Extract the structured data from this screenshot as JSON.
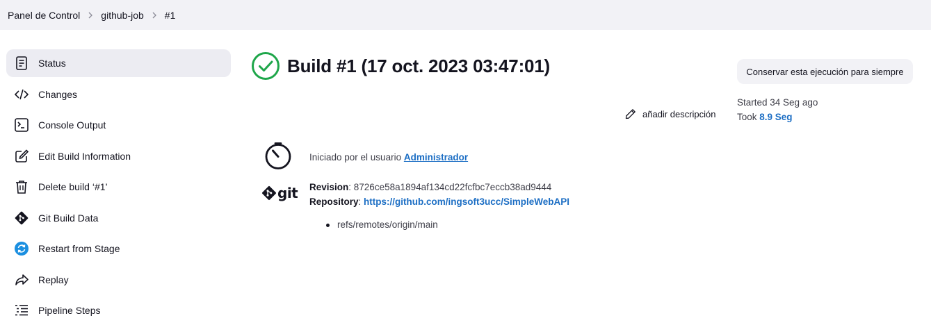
{
  "breadcrumb": {
    "items": [
      "Panel de Control",
      "github-job",
      "#1"
    ]
  },
  "sidebar": {
    "items": [
      {
        "label": "Status",
        "icon": "status-icon",
        "active": true
      },
      {
        "label": "Changes",
        "icon": "code-icon"
      },
      {
        "label": "Console Output",
        "icon": "terminal-icon"
      },
      {
        "label": "Edit Build Information",
        "icon": "edit-icon"
      },
      {
        "label": "Delete build ‘#1’",
        "icon": "trash-icon"
      },
      {
        "label": "Git Build Data",
        "icon": "git-icon"
      },
      {
        "label": "Restart from Stage",
        "icon": "restart-icon"
      },
      {
        "label": "Replay",
        "icon": "replay-icon"
      },
      {
        "label": "Pipeline Steps",
        "icon": "list-icon"
      }
    ]
  },
  "build": {
    "title": "Build #1 (17 oct. 2023 03:47:01)",
    "keep_label": "Conservar esta ejecución para siempre",
    "started": "Started 34 Seg ago",
    "took_prefix": "Took ",
    "took_value": "8.9 Seg",
    "add_description": "añadir descripción",
    "cause_prefix": "Iniciado por el usuario ",
    "cause_user": "Administrador"
  },
  "git": {
    "logo_text": "git",
    "revision_label": "Revision",
    "revision_value": ": 8726ce58a1894af134cd22fcfbc7eccb38ad9444",
    "repository_label": "Repository",
    "repository_sep": ": ",
    "repository_url": "https://github.com/ingsoft3ucc/SimpleWebAPI",
    "branches": [
      "refs/remotes/origin/main"
    ]
  },
  "colors": {
    "success": "#1ea64a",
    "link": "#1c6ec4",
    "restart_icon": "#1b8fe0"
  }
}
